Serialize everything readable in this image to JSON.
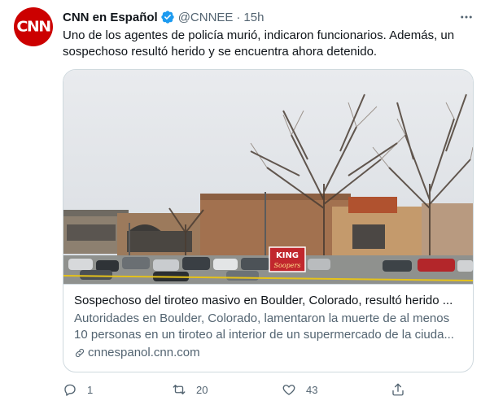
{
  "account": {
    "avatar_text": "CNN",
    "name": "CNN en Español",
    "handle": "@CNNEE",
    "separator": "·",
    "time": "15h",
    "brand_color": "#cc0000",
    "verified_color": "#1d9bf0",
    "verified_icon": "verified-badge-icon"
  },
  "tweet": {
    "text": "Uno de los agentes de policía murió, indicaron funcionarios. Además, un sospechoso resultó herido y se encuentra ahora detenido."
  },
  "card": {
    "image_description_icon": "photo",
    "image_sign_text_top": "KING",
    "image_sign_text_bottom": "Soopers",
    "title": "Sospechoso del tiroteo masivo en Boulder, Colorado, resultó herido ...",
    "description": "Autoridades en Boulder, Colorado, lamentaron la muerte de al menos 10 personas en un tiroteo al interior de un supermercado de la ciuda...",
    "domain": "cnnespanol.cnn.com",
    "link_icon": "link-icon"
  },
  "actions": {
    "reply_count": "1",
    "retweet_count": "20",
    "like_count": "43",
    "share_icon": "share-icon"
  },
  "colors": {
    "text_primary": "#0f1419",
    "text_secondary": "#536471",
    "border": "#cfd9de"
  }
}
